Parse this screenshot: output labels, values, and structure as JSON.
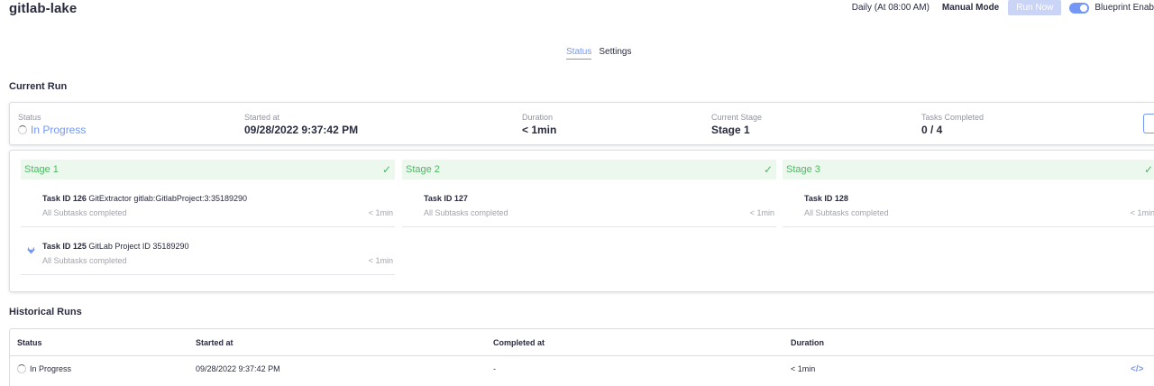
{
  "header": {
    "title": "gitlab-lake",
    "schedule": "Daily (At 08:00 AM)",
    "mode": "Manual Mode",
    "run_now": "Run Now",
    "blueprint_toggle_label": "Blueprint Enab"
  },
  "tabs": [
    {
      "label": "Status",
      "active": true
    },
    {
      "label": "Settings",
      "active": false
    }
  ],
  "current_run": {
    "heading": "Current Run",
    "status_label": "Status",
    "status_value": "In Progress",
    "started_label": "Started at",
    "started_value": "09/28/2022 9:37:42 PM",
    "duration_label": "Duration",
    "duration_value": "< 1min",
    "stage_label": "Current Stage",
    "stage_value": "Stage 1",
    "tasks_label": "Tasks Completed",
    "tasks_value": "0 / 4"
  },
  "stages": [
    {
      "name": "Stage 1",
      "tasks": [
        {
          "id": "Task ID 126",
          "desc": "GitExtractor gitlab:GitlabProject:3:35189290",
          "sub": "All Subtasks completed",
          "duration": "< 1min",
          "icon": "none"
        },
        {
          "id": "Task ID 125",
          "desc": "GitLab Project ID 35189290",
          "sub": "All Subtasks completed",
          "duration": "< 1min",
          "icon": "gitlab-icon"
        }
      ]
    },
    {
      "name": "Stage 2",
      "tasks": [
        {
          "id": "Task ID 127",
          "desc": "",
          "sub": "All Subtasks completed",
          "duration": "< 1min",
          "icon": "none"
        }
      ]
    },
    {
      "name": "Stage 3",
      "tasks": [
        {
          "id": "Task ID 128",
          "desc": "",
          "sub": "All Subtasks completed",
          "duration": "< 1min",
          "icon": "none"
        }
      ]
    }
  ],
  "historical": {
    "heading": "Historical Runs",
    "columns": [
      "Status",
      "Started at",
      "Completed at",
      "Duration"
    ],
    "rows": [
      {
        "status": "In Progress",
        "started": "09/28/2022 9:37:42 PM",
        "completed": "-",
        "duration": "< 1min"
      }
    ]
  },
  "colors": {
    "accent": "#7497f7",
    "success": "#4db764",
    "stage_bg": "#ecf8ee",
    "gitlab": "#6b4fbb"
  }
}
